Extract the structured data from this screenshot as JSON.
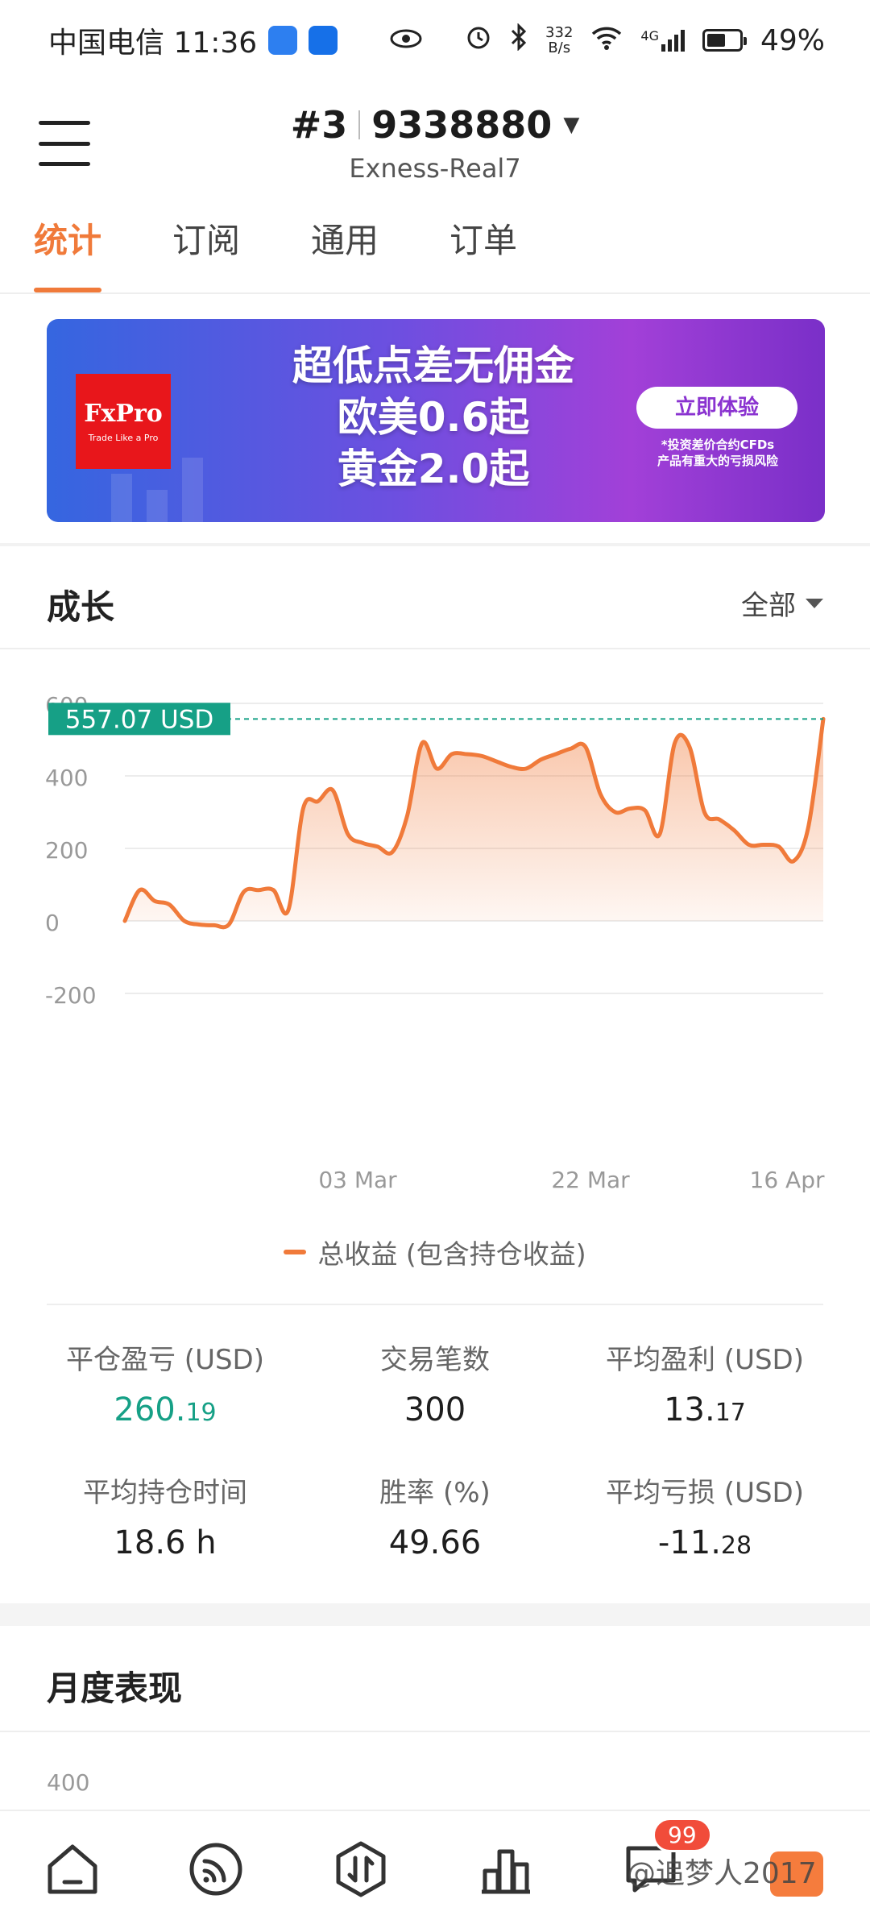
{
  "status_bar": {
    "carrier_time": "中国电信 11:36",
    "speed_value": "332",
    "speed_unit": "B/s",
    "network": "4G",
    "battery": "49%",
    "battery_level": 0.49
  },
  "header": {
    "account_prefix": "#3",
    "account_number": "9338880",
    "server": "Exness-Real7"
  },
  "tabs": [
    "统计",
    "订阅",
    "通用",
    "订单"
  ],
  "active_tab": 0,
  "banner": {
    "brand": "FxPro",
    "brand_tagline": "Trade Like a Pro",
    "line1": "超低点差无佣金",
    "line2": "欧美0.6起",
    "line3": "黄金2.0起",
    "cta": "立即体验",
    "disclaimer_line1": "*投资差价合约CFDs",
    "disclaimer_line2": "产品有重大的亏损风险"
  },
  "growth": {
    "title": "成长",
    "range": "全部"
  },
  "chart_data": {
    "type": "area",
    "current_value_label": "557.07 USD",
    "current_value": 557.07,
    "ylim": [
      -200,
      600
    ],
    "y_ticks": [
      "600",
      "400",
      "200",
      "0",
      "-200"
    ],
    "x_ticks": [
      "03 Mar",
      "22 Mar",
      "16 Apr"
    ],
    "grid": true,
    "legend_position": "bottom",
    "series": [
      {
        "name": "总收益 (包含持仓收益)",
        "color": "#f07a3a",
        "values": [
          0,
          85,
          55,
          45,
          0,
          -10,
          -12,
          -10,
          80,
          85,
          85,
          30,
          310,
          330,
          360,
          240,
          215,
          205,
          190,
          290,
          490,
          420,
          460,
          460,
          455,
          440,
          425,
          420,
          445,
          460,
          475,
          480,
          350,
          300,
          310,
          305,
          240,
          490,
          480,
          300,
          280,
          250,
          210,
          210,
          205,
          165,
          260,
          557.07
        ]
      }
    ]
  },
  "stats": {
    "closed_pl_label": "平仓盈亏 (USD)",
    "closed_pl_int": "260.",
    "closed_pl_dec": "19",
    "trades_label": "交易笔数",
    "trades_value": "300",
    "avg_profit_label": "平均盈利 (USD)",
    "avg_profit_int": "13.",
    "avg_profit_dec": "17",
    "avg_hold_label": "平均持仓时间",
    "avg_hold_value": "18.6 h",
    "winrate_label": "胜率 (%)",
    "winrate_value": "49.66",
    "avg_loss_label": "平均亏损 (USD)",
    "avg_loss_int": "-11.",
    "avg_loss_dec": "28"
  },
  "monthly": {
    "title": "月度表现",
    "top_tick": "400"
  },
  "bottom_nav": {
    "badge": "99",
    "watermark": "@追梦人2017"
  }
}
